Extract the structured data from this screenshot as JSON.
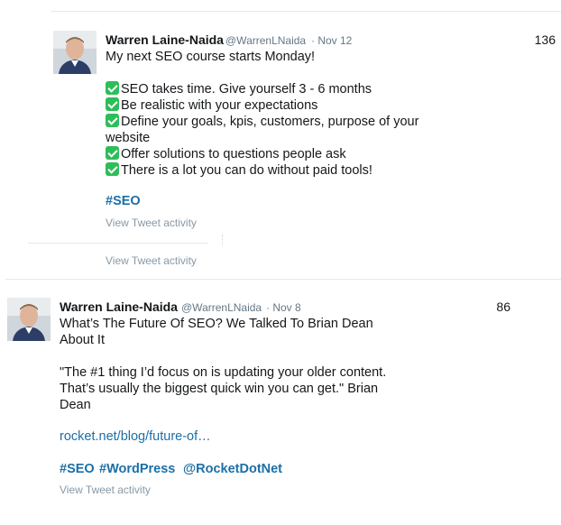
{
  "tweets": [
    {
      "author_name": "Warren Laine-Naida",
      "handle": "@WarrenLNaida",
      "date": "· Nov 12",
      "count": "136",
      "lines": [
        "My next SEO course starts Monday!",
        "SEO takes time. Give yourself 3 - 6 months",
        "Be realistic with your expectations",
        "Define your goals, kpis, customers, purpose of your",
        "website",
        "Offer solutions to questions people ask",
        "There is a lot you can do without paid tools!"
      ],
      "hashtag": "#SEO",
      "activity_label": "View Tweet activity",
      "activity_label_2": "View Tweet activity"
    },
    {
      "author_name": "Warren Laine-Naida",
      "handle": "@WarrenLNaida",
      "date": "· Nov 8",
      "count": "86",
      "lines": [
        "What’s The Future Of SEO? We Talked To Brian Dean",
        "About It",
        "\"The #1 thing I’d focus on is updating your older content.",
        "That’s usually the biggest quick win you can get.\" Brian",
        "Dean"
      ],
      "link": "rocket.net/blog/future-of…",
      "tags": [
        "#SEO",
        "#WordPress",
        "@RocketDotNet"
      ],
      "activity_label": "View Tweet activity"
    }
  ],
  "colors": {
    "link": "#1b6fa8",
    "check": "#2ebd59",
    "muted": "#657786",
    "divider": "#e1e8ed"
  }
}
